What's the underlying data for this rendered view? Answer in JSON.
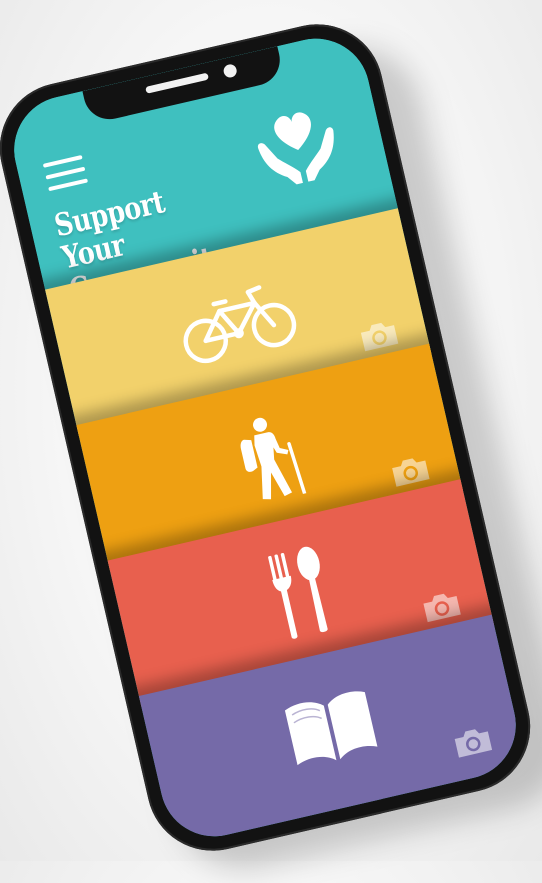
{
  "app": {
    "title": "Support Your Community",
    "title_line1": "Support Your",
    "title_line2": "Community"
  },
  "header": {
    "menu_icon": "hamburger-menu-icon",
    "logo_icon": "heart-in-hands-icon"
  },
  "categories": [
    {
      "icon": "bicycle-icon",
      "color": "#f2d16b",
      "photo_icon": "camera-icon"
    },
    {
      "icon": "hiker-icon",
      "color": "#eea012",
      "photo_icon": "camera-icon"
    },
    {
      "icon": "fork-spoon-icon",
      "color": "#e8604e",
      "photo_icon": "camera-icon"
    },
    {
      "icon": "open-book-icon",
      "color": "#756aa8",
      "photo_icon": "camera-icon"
    }
  ],
  "colors": {
    "header_teal": "#3fc0bf",
    "phone_frame": "#121212"
  }
}
